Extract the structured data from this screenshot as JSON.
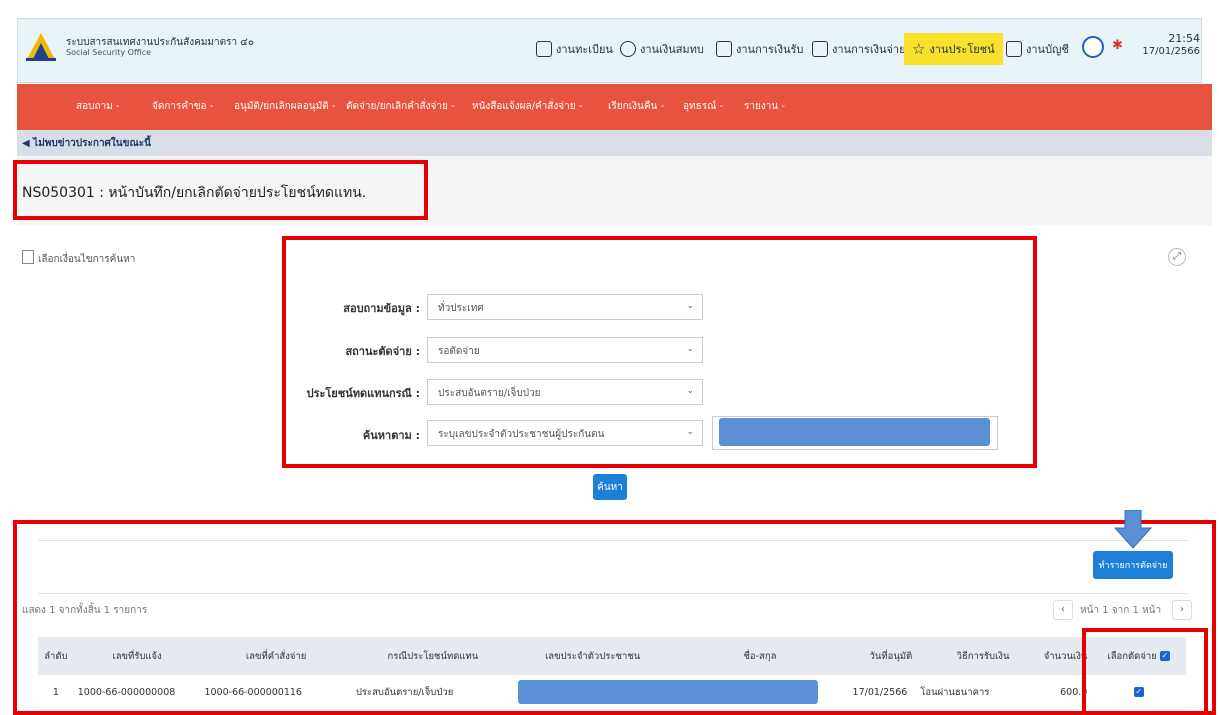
{
  "header": {
    "org_th": "ระบบสารสนเทศงานประกันสังคมมาตรา ๔๐",
    "org_en": "Social Security Office",
    "menu": [
      {
        "label": "งานทะเบียน",
        "icon": "book-icon"
      },
      {
        "label": "งานเงินสมทบ",
        "icon": "plus-circle-icon"
      },
      {
        "label": "งานการเงินรับ",
        "icon": "folder-icon"
      },
      {
        "label": "งานการเงินจ่าย",
        "icon": "calculator-icon"
      },
      {
        "label": "งานประโยชน์",
        "icon": "star-icon"
      },
      {
        "label": "งานบัญชี",
        "icon": "edit-icon"
      }
    ],
    "time": "21:54",
    "date": "17/01/2566"
  },
  "nav": {
    "items": [
      "สอบถาม -",
      "จัดการคำขอ -",
      "อนุมัติ/ยกเลิกผลอนุมัติ -",
      "ตัดจ่าย/ยกเลิกคำสั่งจ่าย -",
      "หนังสือแจ้งผล/คำสั่งจ่าย -",
      "เรียกเงินคืน -",
      "อุทธรณ์ -",
      "รายงาน -"
    ]
  },
  "news": "ไม่พบข่าวประกาศในขณะนี้",
  "page_title": "NS050301 : หน้าบันทึก/ยกเลิกตัดจ่ายประโยชน์ทดแทน.",
  "search": {
    "condition_label": "เลือกเงื่อนไขการค้นหา",
    "fields": [
      {
        "label": "สอบถามข้อมูล :",
        "value": "ทั่วประเทศ"
      },
      {
        "label": "สถานะตัดจ่าย :",
        "value": "รอตัดจ่าย"
      },
      {
        "label": "ประโยชน์ทดแทนกรณี :",
        "value": "ประสบอันตราย/เจ็บป่วย"
      },
      {
        "label": "ค้นหาตาม :",
        "value": "ระบุเลขประจำตัวประชาชนผู้ประกันตน"
      }
    ],
    "button": "ค้นหา"
  },
  "results": {
    "cut_button": "ทำรายการตัดจ่าย",
    "count_text": "แสดง 1 จากทั้งสิ้น 1 รายการ",
    "pager_text": "หน้า 1 จาก 1 หน้า",
    "columns": [
      "ลำดับ",
      "เลขที่รับแจ้ง",
      "เลขที่คำสั่งจ่าย",
      "กรณีประโยชน์ทดแทน",
      "เลขประจำตัวประชาชน",
      "ชื่อ-สกุล",
      "วันที่อนุมัติ",
      "วิธีการรับเงิน",
      "จำนวนเงิน",
      "เลือกตัดจ่าย"
    ],
    "rows": [
      {
        "no": "1",
        "notify_no": "1000-66-000000008",
        "order_no": "1000-66-000000116",
        "case": "ประสบอันตราย/เจ็บป่วย",
        "approve_date": "17/01/2566",
        "method": "โอนผ่านธนาคาร",
        "amount": "600.0"
      }
    ]
  }
}
